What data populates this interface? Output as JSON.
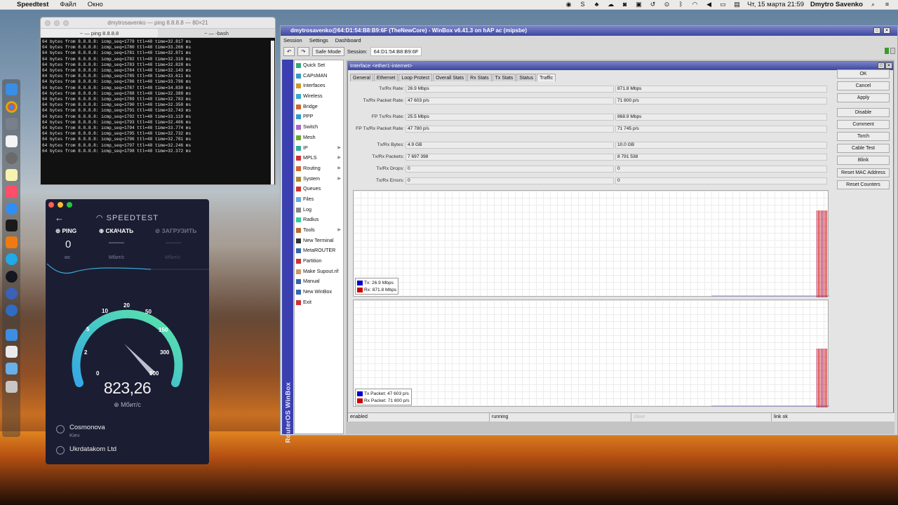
{
  "menubar": {
    "app": "Speedtest",
    "items": [
      "Файл",
      "Окно"
    ],
    "user": "Dmytro Savenko",
    "clock": "Чт, 15 марта  21:59"
  },
  "terminal": {
    "title": "dmytrosavenko — ping 8.8.8.8 — 80×21",
    "tab1": "~ — ping 8.8.8.8",
    "tab2": "~ — -bash",
    "lines": [
      "64 bytes from 8.8.8.8: icmp_seq=1779 ttl=48 time=32.817 ms",
      "64 bytes from 8.8.8.8: icmp_seq=1780 ttl=48 time=33.266 ms",
      "64 bytes from 8.8.8.8: icmp_seq=1781 ttl=48 time=32.871 ms",
      "64 bytes from 8.8.8.8: icmp_seq=1782 ttl=48 time=32.310 ms",
      "64 bytes from 8.8.8.8: icmp_seq=1783 ttl=48 time=32.828 ms",
      "64 bytes from 8.8.8.8: icmp_seq=1784 ttl=48 time=32.143 ms",
      "64 bytes from 8.8.8.8: icmp_seq=1785 ttl=48 time=33.611 ms",
      "64 bytes from 8.8.8.8: icmp_seq=1786 ttl=48 time=33.796 ms",
      "64 bytes from 8.8.8.8: icmp_seq=1787 ttl=48 time=34.830 ms",
      "64 bytes from 8.8.8.8: icmp_seq=1788 ttl=48 time=32.388 ms",
      "64 bytes from 8.8.8.8: icmp_seq=1789 ttl=48 time=32.783 ms",
      "64 bytes from 8.8.8.8: icmp_seq=1790 ttl=48 time=32.358 ms",
      "64 bytes from 8.8.8.8: icmp_seq=1791 ttl=48 time=32.743 ms",
      "64 bytes from 8.8.8.8: icmp_seq=1792 ttl=48 time=33.119 ms",
      "64 bytes from 8.8.8.8: icmp_seq=1793 ttl=48 time=32.406 ms",
      "64 bytes from 8.8.8.8: icmp_seq=1794 ttl=48 time=33.774 ms",
      "64 bytes from 8.8.8.8: icmp_seq=1795 ttl=48 time=32.732 ms",
      "64 bytes from 8.8.8.8: icmp_seq=1796 ttl=48 time=32.781 ms",
      "64 bytes from 8.8.8.8: icmp_seq=1797 ttl=48 time=32.246 ms",
      "64 bytes from 8.8.8.8: icmp_seq=1798 ttl=48 time=32.372 ms"
    ]
  },
  "speedtest": {
    "title": "SPEEDTEST",
    "ping_label": "PING",
    "download_label": "СКАЧАТЬ",
    "upload_label": "ЗАГРУЗИТЬ",
    "ping_value": "0",
    "download_value": "——",
    "upload_value": "——",
    "unit_ms": "мс",
    "unit_mbps": "Мбит/с",
    "unit_mbps2": "Мбит/с",
    "gauge_ticks": [
      "0",
      "2",
      "5",
      "10",
      "20",
      "50",
      "150",
      "300",
      "500"
    ],
    "result": "823,26",
    "result_unit": "Мбит/с",
    "server": "Cosmonova",
    "city": "Kiev",
    "isp": "Ukrdatakom Ltd"
  },
  "winbox": {
    "title": "dmytrosavenko@64:D1:54:B8:B9:6F (TheNewCore) - WinBox v6.41.3 on hAP ac (mipsbe)",
    "menu": [
      "Session",
      "Settings",
      "Dashboard"
    ],
    "safe_mode": "Safe Mode",
    "session_label": "Session:",
    "session_value": "64:D1:54:B8:B9:6F",
    "side_label": "RouterOS WinBox",
    "nav": [
      "Quick Set",
      "CAPsMAN",
      "Interfaces",
      "Wireless",
      "Bridge",
      "PPP",
      "Switch",
      "Mesh",
      "IP",
      "MPLS",
      "Routing",
      "System",
      "Queues",
      "Files",
      "Log",
      "Radius",
      "Tools",
      "New Terminal",
      "MetaROUTER",
      "Partition",
      "Make Supout.rif",
      "Manual",
      "New WinBox",
      "Exit"
    ],
    "iface_title": "Interface <ether1-internet>",
    "tabs": [
      "General",
      "Ethernet",
      "Loop Protect",
      "Overall Stats",
      "Rx Stats",
      "Tx Stats",
      "Status",
      "Traffic"
    ],
    "fields": [
      {
        "label": "Tx/Rx Rate:",
        "tx": "26.9 Mbps",
        "rx": "871.8 Mbps"
      },
      {
        "label": "Tx/Rx Packet Rate:",
        "tx": "47 603 p/s",
        "rx": "71 800 p/s"
      },
      {
        "label": "FP Tx/Rx Rate:",
        "tx": "25.5 Mbps",
        "rx": "868.9 Mbps"
      },
      {
        "label": "FP Tx/Rx Packet Rate:",
        "tx": "47 780 p/s",
        "rx": "71 745 p/s"
      },
      {
        "label": "Tx/Rx Bytes:",
        "tx": "4.9 GB",
        "rx": "10.0 GB"
      },
      {
        "label": "Tx/Rx Packets:",
        "tx": "7 697 398",
        "rx": "8 791 538"
      },
      {
        "label": "Tx/Rx Drops:",
        "tx": "0",
        "rx": "0"
      },
      {
        "label": "Tx/Rx Errors:",
        "tx": "0",
        "rx": "0"
      }
    ],
    "legend1": {
      "tx": "Tx:  26.9 Mbps",
      "rx": "Rx:  871.8 Mbps"
    },
    "legend2": {
      "tx": "Tx Packet:  47 603 p/s",
      "rx": "Rx Packet:  71 800 p/s"
    },
    "buttons": [
      "OK",
      "Cancel",
      "Apply",
      "Disable",
      "Comment",
      "Torch",
      "Cable Test",
      "Blink",
      "Reset MAC Address",
      "Reset Counters"
    ],
    "status": [
      "enabled",
      "running",
      "slave",
      "link ok"
    ]
  },
  "colors": {
    "tx": "#0000cc",
    "rx": "#cc0000",
    "gauge_start": "#35a8e6",
    "gauge_end": "#5be7a6"
  }
}
